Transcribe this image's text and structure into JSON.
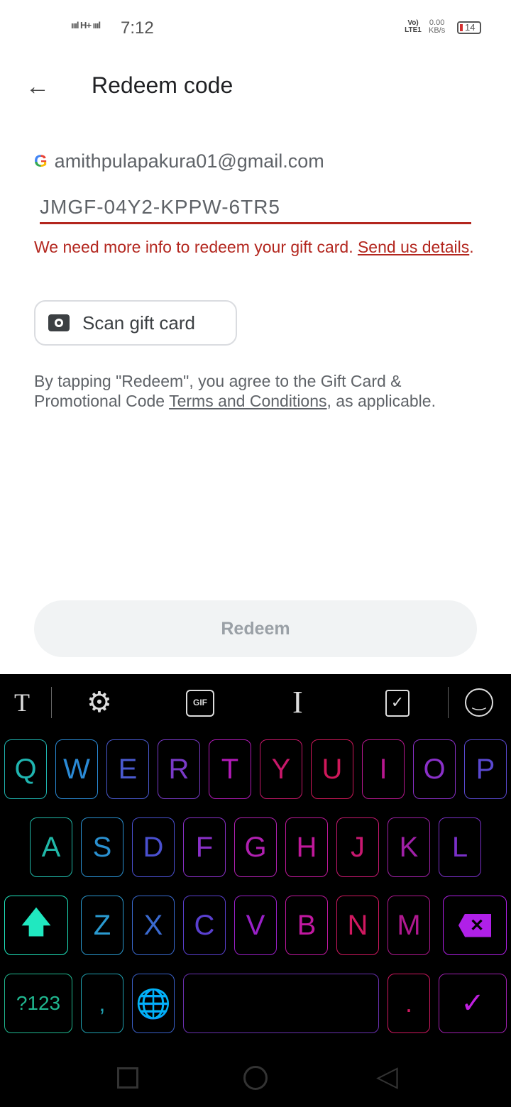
{
  "status": {
    "signal": "ıııl H+ ıııl",
    "time": "7:12",
    "volte": "Vo) LTE1",
    "speed": "0.00",
    "speed_unit": "KB/s",
    "battery": "14"
  },
  "header": {
    "title": "Redeem code",
    "back_icon": "arrow-left-icon"
  },
  "account": {
    "email": "amithpulapakura01@gmail.com",
    "icon": "google-g-icon"
  },
  "code_input": {
    "value": "JMGF-04Y2-KPPW-6TR5"
  },
  "error": {
    "text": "We need more info to redeem your gift card. ",
    "link": "Send us details",
    "end": "."
  },
  "scan_button": {
    "label": "Scan gift card",
    "icon": "camera-icon"
  },
  "terms": {
    "pre": "By tapping \"Redeem\", you agree to the Gift Card & Promotional Code ",
    "link": "Terms and Conditions",
    "post": ", as applicable."
  },
  "redeem_button": {
    "label": "Redeem"
  },
  "keyboard": {
    "toolbar": {
      "text": "T",
      "gif": "GIF",
      "cursor": "I"
    },
    "rows": [
      [
        {
          "k": "Q",
          "c": "#1fb5b0"
        },
        {
          "k": "W",
          "c": "#2a8ad6"
        },
        {
          "k": "E",
          "c": "#4a5ad0"
        },
        {
          "k": "R",
          "c": "#7a3ac8"
        },
        {
          "k": "T",
          "c": "#b21ab8"
        },
        {
          "k": "Y",
          "c": "#c8186a"
        },
        {
          "k": "U",
          "c": "#d0185a"
        },
        {
          "k": "I",
          "c": "#b81890"
        },
        {
          "k": "O",
          "c": "#8a30c8"
        },
        {
          "k": "P",
          "c": "#5a48d0"
        }
      ],
      [
        {
          "k": "A",
          "c": "#20b8a8"
        },
        {
          "k": "S",
          "c": "#2a90d0"
        },
        {
          "k": "D",
          "c": "#4a50d0"
        },
        {
          "k": "F",
          "c": "#8a30c8"
        },
        {
          "k": "G",
          "c": "#b020b0"
        },
        {
          "k": "H",
          "c": "#c0189a"
        },
        {
          "k": "J",
          "c": "#c81870"
        },
        {
          "k": "K",
          "c": "#a020a8"
        },
        {
          "k": "L",
          "c": "#7a30c8"
        }
      ],
      [
        {
          "k": "Z",
          "c": "#2a9ad0"
        },
        {
          "k": "X",
          "c": "#3a6ad0"
        },
        {
          "k": "C",
          "c": "#5a40d0"
        },
        {
          "k": "V",
          "c": "#9a20c8"
        },
        {
          "k": "B",
          "c": "#c018a0"
        },
        {
          "k": "N",
          "c": "#d01860"
        },
        {
          "k": "M",
          "c": "#b01890"
        }
      ]
    ],
    "symbols": "?123",
    "comma": ",",
    "period": ".",
    "colors": {
      "shift": "#20e8c0",
      "delete": "#b020e8",
      "symbols": "#20b890",
      "comma": "#20a0b0",
      "globe": "#2090e8",
      "period": "#d01860",
      "enter": "#c020e0"
    }
  }
}
